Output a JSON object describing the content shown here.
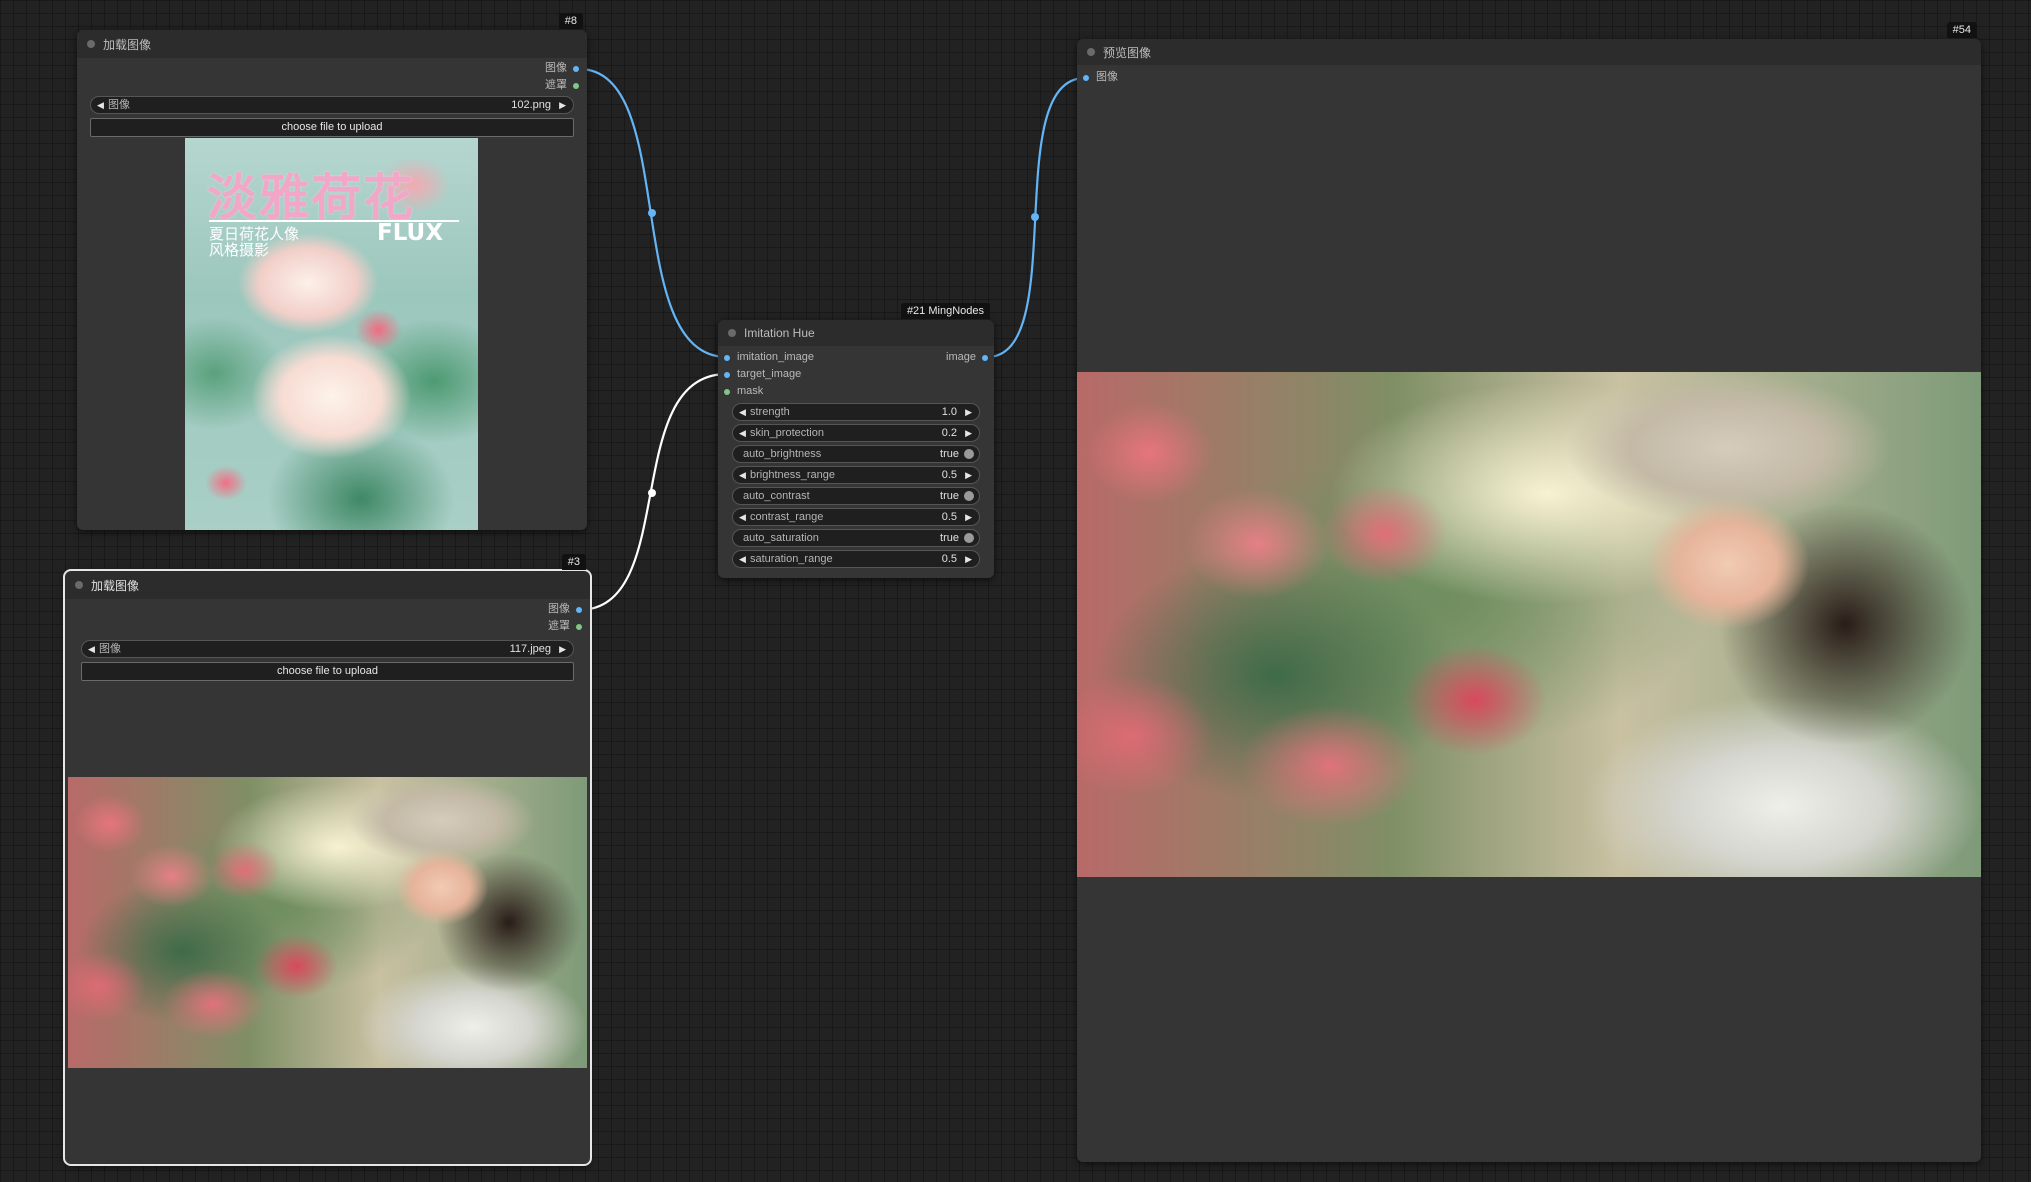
{
  "nodes": {
    "load_image_top": {
      "id_badge": "#8",
      "title": "加载图像",
      "outputs": [
        {
          "label": "图像",
          "type": "image"
        },
        {
          "label": "遮罩",
          "type": "mask"
        }
      ],
      "image_widget": {
        "name": "图像",
        "value": "102.png"
      },
      "upload_label": "choose file to upload",
      "preview": {
        "title_text": "淡雅荷花",
        "subtitle_text": "夏日荷花人像\n风格摄影",
        "brand_text": "FLUX"
      }
    },
    "load_image_bottom": {
      "id_badge": "#3",
      "title": "加载图像",
      "outputs": [
        {
          "label": "图像",
          "type": "image"
        },
        {
          "label": "遮罩",
          "type": "mask"
        }
      ],
      "image_widget": {
        "name": "图像",
        "value": "117.jpeg"
      },
      "upload_label": "choose file to upload"
    },
    "imitation_hue": {
      "id_badge": "#21 MingNodes",
      "title": "Imitation Hue",
      "inputs": [
        {
          "label": "imitation_image",
          "type": "image"
        },
        {
          "label": "target_image",
          "type": "image"
        },
        {
          "label": "mask",
          "type": "mask"
        }
      ],
      "outputs": [
        {
          "label": "image",
          "type": "image"
        }
      ],
      "widgets": [
        {
          "name": "strength",
          "value": "1.0",
          "kind": "number"
        },
        {
          "name": "skin_protection",
          "value": "0.2",
          "kind": "number"
        },
        {
          "name": "auto_brightness",
          "value": "true",
          "kind": "toggle"
        },
        {
          "name": "brightness_range",
          "value": "0.5",
          "kind": "number"
        },
        {
          "name": "auto_contrast",
          "value": "true",
          "kind": "toggle"
        },
        {
          "name": "contrast_range",
          "value": "0.5",
          "kind": "number"
        },
        {
          "name": "auto_saturation",
          "value": "true",
          "kind": "toggle"
        },
        {
          "name": "saturation_range",
          "value": "0.5",
          "kind": "number"
        }
      ]
    },
    "preview_image": {
      "id_badge": "#54",
      "title": "预览图像",
      "inputs": [
        {
          "label": "图像",
          "type": "image"
        }
      ]
    }
  },
  "colors": {
    "canvas_bg": "#222222",
    "node_bg": "#353535",
    "node_header": "#2c2c2c",
    "image_slot": "#64b5f6",
    "mask_slot": "#81c784",
    "link_image": "#64b5f6",
    "link_selected": "#ffffff"
  }
}
